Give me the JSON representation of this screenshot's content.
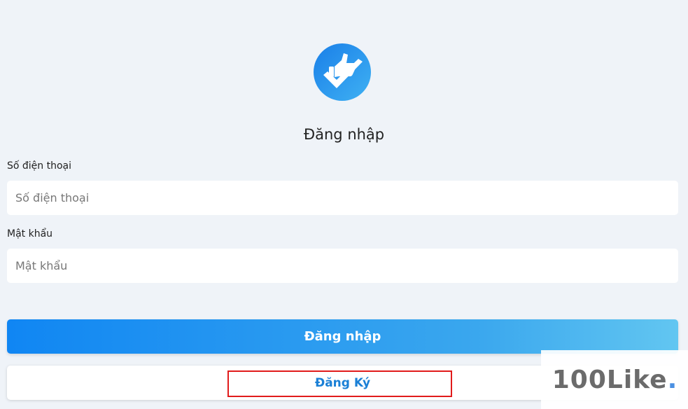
{
  "logo": {
    "icon": "thumbs-up-check-icon",
    "color": "#1e8fee"
  },
  "title": "Đăng nhập",
  "phone": {
    "label": "Số điện thoại",
    "placeholder": "Số điện thoại",
    "value": ""
  },
  "password": {
    "label": "Mật khẩu",
    "placeholder": "Mật khẩu",
    "value": ""
  },
  "login_button": "Đăng nhập",
  "register_button": "Đăng Ký",
  "watermark": {
    "text": "100Like",
    "dot": ".",
    "dot_color": "#4a90e2"
  }
}
